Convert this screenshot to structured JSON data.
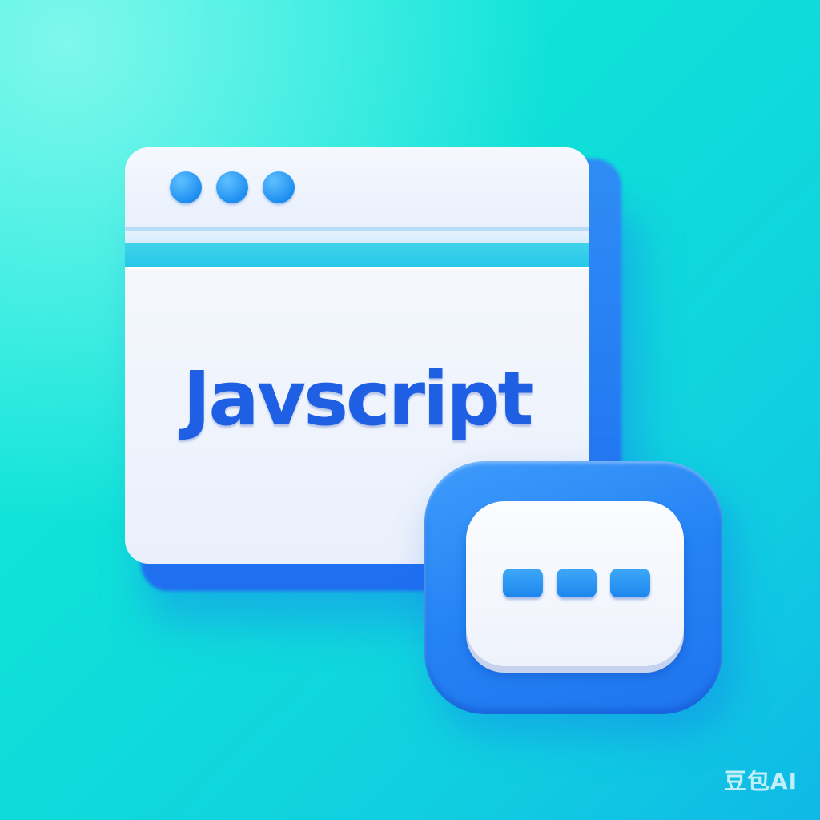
{
  "window": {
    "headline": "Javscript",
    "titlebar_dots": 3
  },
  "badge": {
    "squares": 3
  },
  "watermark": "豆包AI",
  "colors": {
    "background": "#13ecdc",
    "accent_blue": "#1e5fe3",
    "button_blue": "#2483f4",
    "stripe_cyan": "#27c6ea"
  },
  "icons": [
    "window-control-dot",
    "more-options-square"
  ]
}
